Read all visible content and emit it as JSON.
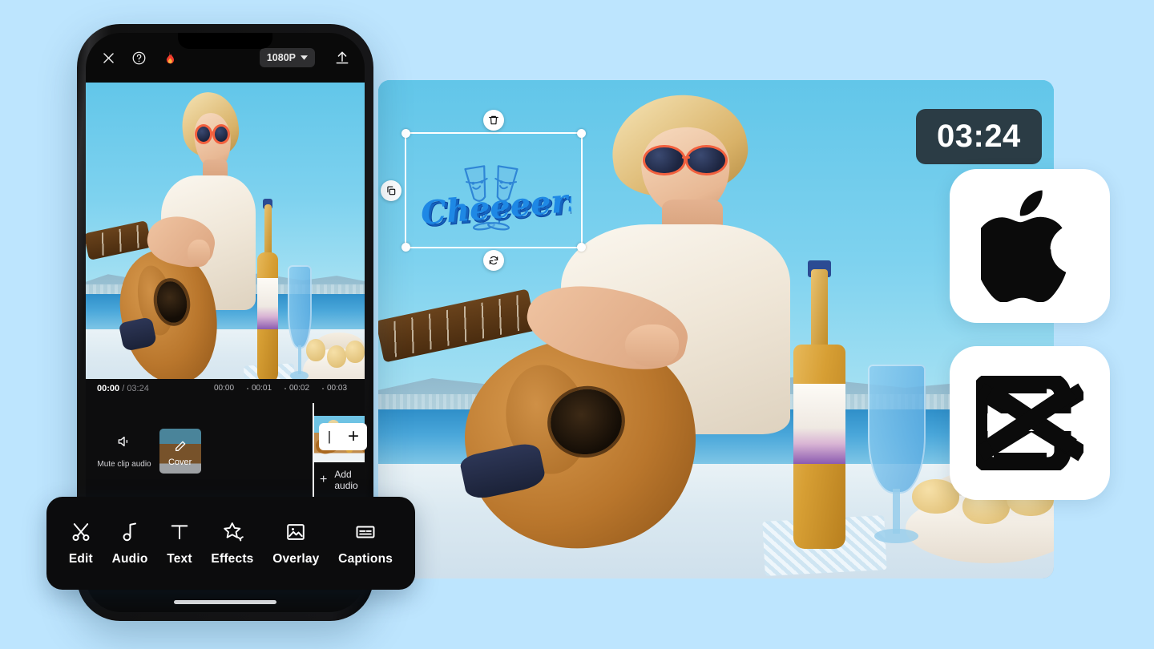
{
  "app": {
    "background_color": "#bde5fe",
    "duration_badge": "03:24"
  },
  "phone": {
    "topbar": {
      "close_icon": "close-icon",
      "help_icon": "help-icon",
      "flame_icon": "flame-icon",
      "resolution_label": "1080P",
      "resolution_caret": "chevron-down-icon",
      "export_icon": "upload-icon"
    },
    "preview": {
      "label": "video-preview"
    },
    "timeline": {
      "current_time": "00:00",
      "total_time": "/ 03:24",
      "ruler_ticks": [
        "00:00",
        "00:01",
        "00:02",
        "00:03"
      ],
      "mute_label": "Mute clip audio",
      "mute_icon": "speaker-mute-icon",
      "cover_label": "Cover",
      "cover_edit_icon": "pencil-icon",
      "clip_end_divider": "|",
      "clip_add_label": "+",
      "add_audio_plus": "+",
      "add_audio_label": "Add audio"
    }
  },
  "toolbar": {
    "items": [
      {
        "label": "Edit",
        "icon": "scissors-icon"
      },
      {
        "label": "Audio",
        "icon": "music-note-icon"
      },
      {
        "label": "Text",
        "icon": "text-t-icon"
      },
      {
        "label": "Effects",
        "icon": "sparkle-star-icon"
      },
      {
        "label": "Overlay",
        "icon": "image-overlay-icon"
      },
      {
        "label": "Captions",
        "icon": "captions-icon"
      }
    ]
  },
  "sticker": {
    "name": "Cheeeers!",
    "delete_icon": "trash-icon",
    "rotate_icon": "rotate-icon",
    "copy_icon": "duplicate-icon",
    "art": "champagne-glasses-cheers-sticker"
  },
  "store_badges": [
    {
      "name": "apple-logo",
      "icon": "apple-icon"
    },
    {
      "name": "capcut-logo",
      "icon": "capcut-icon"
    }
  ]
}
